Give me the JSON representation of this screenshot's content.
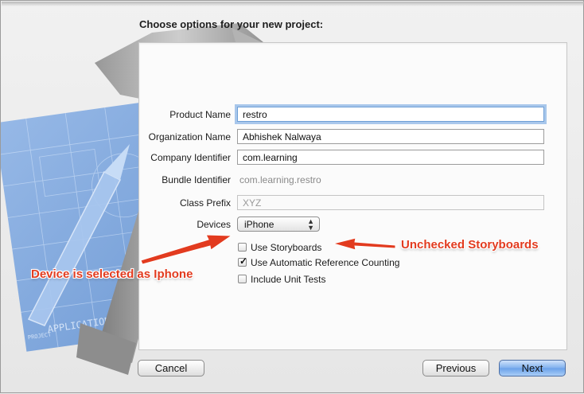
{
  "dialog": {
    "title": "Choose options for your new project:"
  },
  "form": {
    "product_name": {
      "label": "Product Name",
      "value": "restro"
    },
    "organization_name": {
      "label": "Organization Name",
      "value": "Abhishek Nalwaya"
    },
    "company_identifier": {
      "label": "Company Identifier",
      "value": "com.learning"
    },
    "bundle_identifier": {
      "label": "Bundle Identifier",
      "value": "com.learning.restro"
    },
    "class_prefix": {
      "label": "Class Prefix",
      "value": "XYZ"
    },
    "devices": {
      "label": "Devices",
      "selected": "iPhone"
    }
  },
  "options": [
    {
      "label": "Use Storyboards",
      "checked": false
    },
    {
      "label": "Use Automatic Reference Counting",
      "checked": true
    },
    {
      "label": "Include Unit Tests",
      "checked": false
    }
  ],
  "buttons": {
    "cancel": "Cancel",
    "previous": "Previous",
    "next": "Next"
  },
  "annotations": {
    "storyboards_note": "Unchecked  Storyboards",
    "device_note": "Device is selected as Iphone",
    "color": "#e23b1f"
  },
  "artwork": {
    "blueprint_text": "APPLICATION APP",
    "blueprint_subtext": "PROJECT"
  }
}
